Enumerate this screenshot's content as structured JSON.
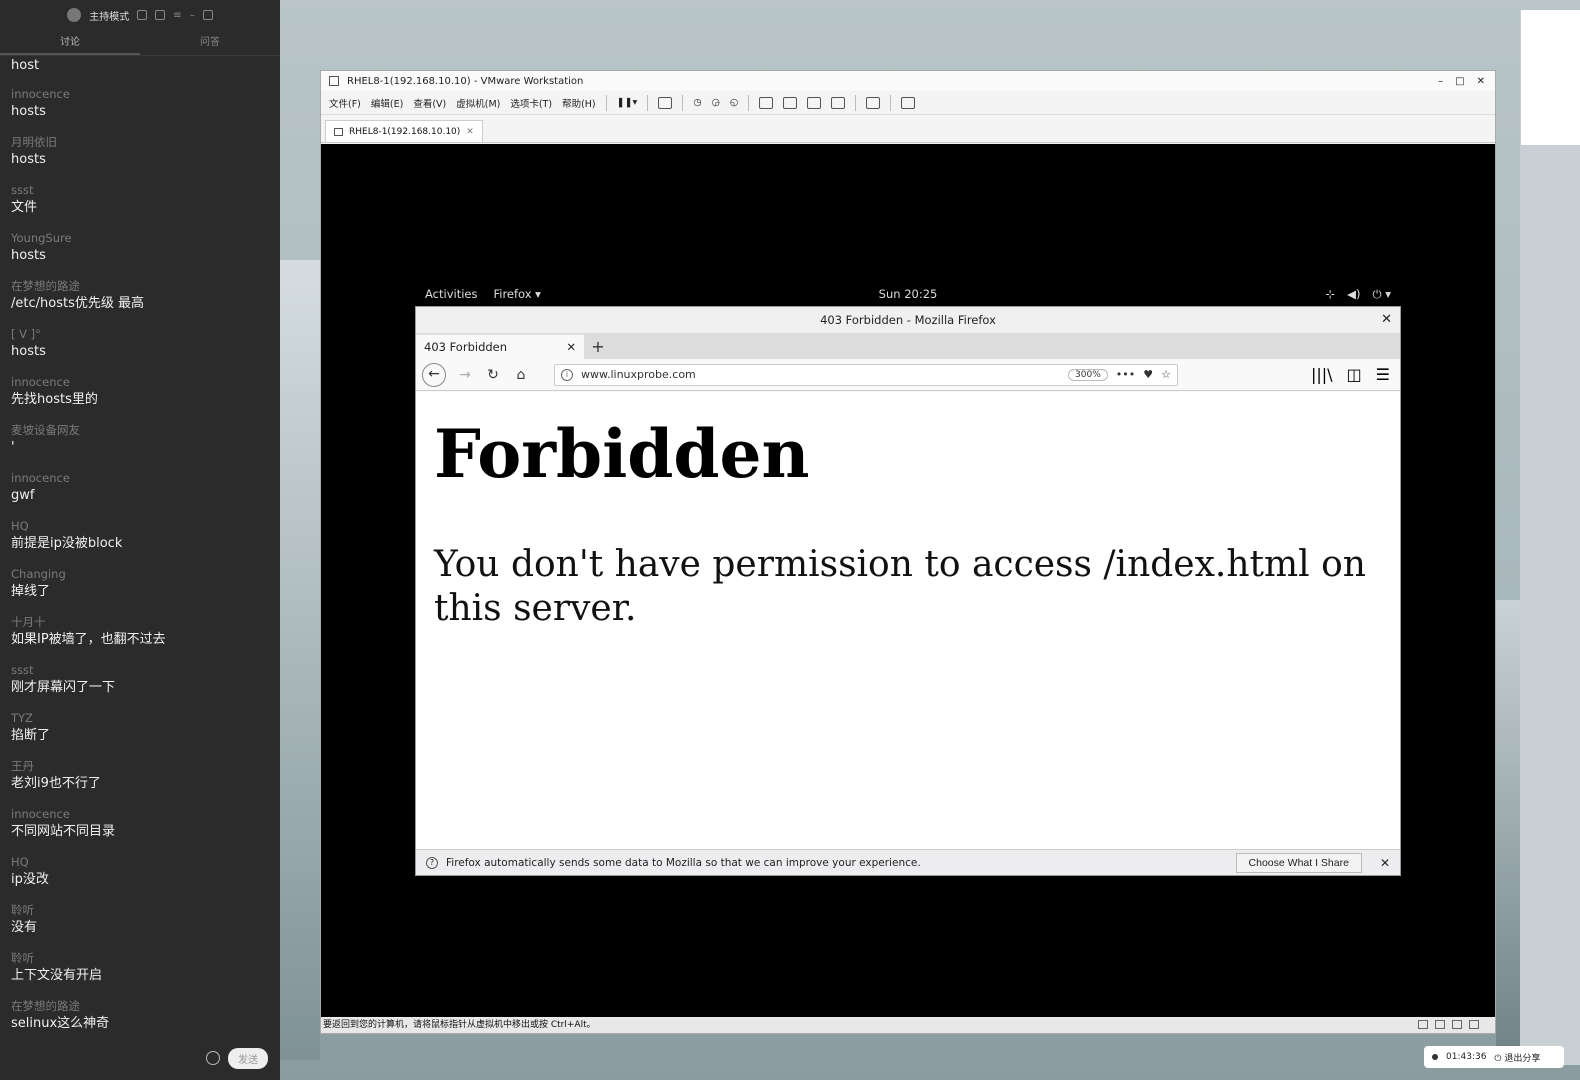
{
  "chat": {
    "host_mode": "主持模式",
    "tabs": [
      "讨论",
      "问答"
    ],
    "first_text": "host",
    "messages": [
      {
        "name": "innocence",
        "text": "hosts"
      },
      {
        "name": "月明依旧",
        "text": "hosts"
      },
      {
        "name": "ssst",
        "text": "文件"
      },
      {
        "name": "YoungSure",
        "text": "hosts"
      },
      {
        "name": "在梦想的路途",
        "text": "/etc/hosts优先级 最高"
      },
      {
        "name": "[ V ]°",
        "text": "hosts"
      },
      {
        "name": "innocence",
        "text": "先找hosts里的"
      },
      {
        "name": "麦坡设备网友",
        "text": "'"
      },
      {
        "name": "innocence",
        "text": "gwf"
      },
      {
        "name": "HQ",
        "text": "前提是ip没被block"
      },
      {
        "name": "Changing",
        "text": "掉线了"
      },
      {
        "name": "十月十",
        "text": "如果IP被墙了，也翻不过去"
      },
      {
        "name": "ssst",
        "text": "刚才屏幕闪了一下"
      },
      {
        "name": "TYZ",
        "text": "掐断了"
      },
      {
        "name": "王丹",
        "text": "老刘i9也不行了"
      },
      {
        "name": "innocence",
        "text": "不同网站不同目录"
      },
      {
        "name": "HQ",
        "text": "ip没改"
      },
      {
        "name": "聆听",
        "text": "没有"
      },
      {
        "name": "聆听",
        "text": "上下文没有开启"
      },
      {
        "name": "在梦想的路途",
        "text": "selinux这么神奇"
      }
    ],
    "send": "发送"
  },
  "vmware": {
    "title": "RHEL8-1(192.168.10.10) - VMware Workstation",
    "menu": [
      "文件(F)",
      "编辑(E)",
      "查看(V)",
      "虚拟机(M)",
      "选项卡(T)",
      "帮助(H)"
    ],
    "tab": "RHEL8-1(192.168.10.10)",
    "status": "要返回到您的计算机，请将鼠标指针从虚拟机中移出或按 Ctrl+Alt。"
  },
  "gnome": {
    "activities": "Activities",
    "app": "Firefox",
    "clock": "Sun 20:25"
  },
  "firefox": {
    "window_title": "403 Forbidden - Mozilla Firefox",
    "tab_title": "403 Forbidden",
    "url": "www.linuxprobe.com",
    "zoom": "300%",
    "heading": "Forbidden",
    "message": "You don't have permission to access /index.html on this server.",
    "notice": "Firefox automatically sends some data to Mozilla so that we can improve your experience.",
    "notice_button": "Choose What I Share"
  },
  "sharebar": {
    "time": "01:43:36",
    "exit": "退出分享"
  }
}
